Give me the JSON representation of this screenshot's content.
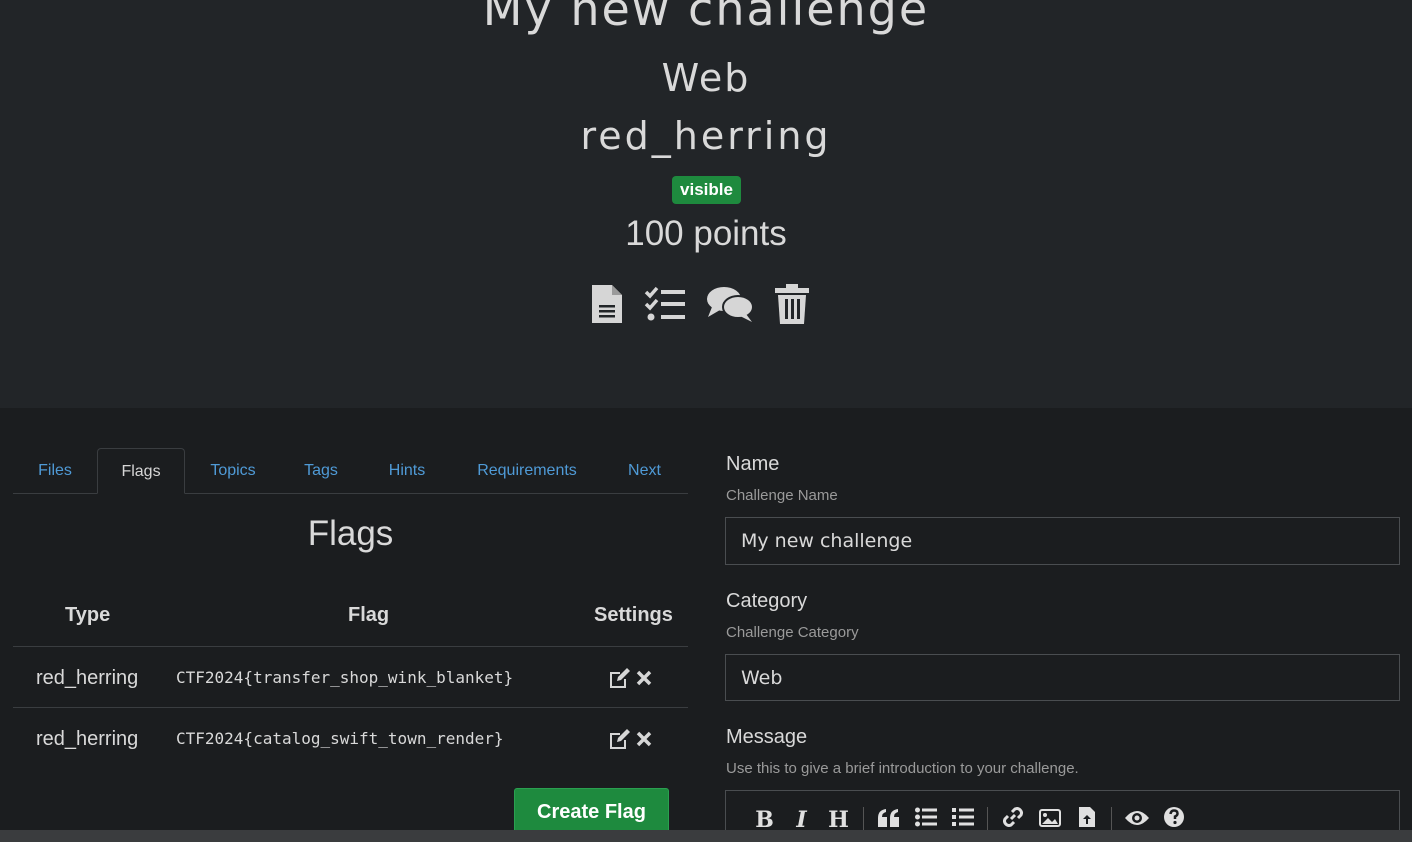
{
  "challenge": {
    "title": "My new challenge",
    "category": "Web",
    "type": "red_herring",
    "state_badge": "visible",
    "points": "100 points",
    "action_icons": [
      "file-text-icon",
      "tasks-icon",
      "comments-icon",
      "trash-icon"
    ]
  },
  "tabs": [
    {
      "label": "Files",
      "active": false
    },
    {
      "label": "Flags",
      "active": true
    },
    {
      "label": "Topics",
      "active": false
    },
    {
      "label": "Tags",
      "active": false
    },
    {
      "label": "Hints",
      "active": false
    },
    {
      "label": "Requirements",
      "active": false
    },
    {
      "label": "Next",
      "active": false
    }
  ],
  "flags": {
    "heading": "Flags",
    "columns": [
      "Type",
      "Flag",
      "Settings"
    ],
    "rows": [
      {
        "type": "red_herring",
        "flag": "CTF2024{transfer_shop_wink_blanket}"
      },
      {
        "type": "red_herring",
        "flag": "CTF2024{catalog_swift_town_render}"
      }
    ],
    "create_label": "Create Flag"
  },
  "form": {
    "name_label": "Name",
    "name_help": "Challenge Name",
    "name_value": "My new challenge",
    "category_label": "Category",
    "category_help": "Challenge Category",
    "category_value": "Web",
    "message_label": "Message",
    "message_help": "Use this to give a brief introduction to your challenge.",
    "toolbar": [
      "bold",
      "italic",
      "heading",
      "quote",
      "unordered-list",
      "ordered-list",
      "link",
      "image",
      "upload",
      "preview",
      "guide"
    ]
  },
  "colors": {
    "badge": "#1e8a3e",
    "link": "#4f9ad6",
    "button": "#1e8a3e"
  }
}
